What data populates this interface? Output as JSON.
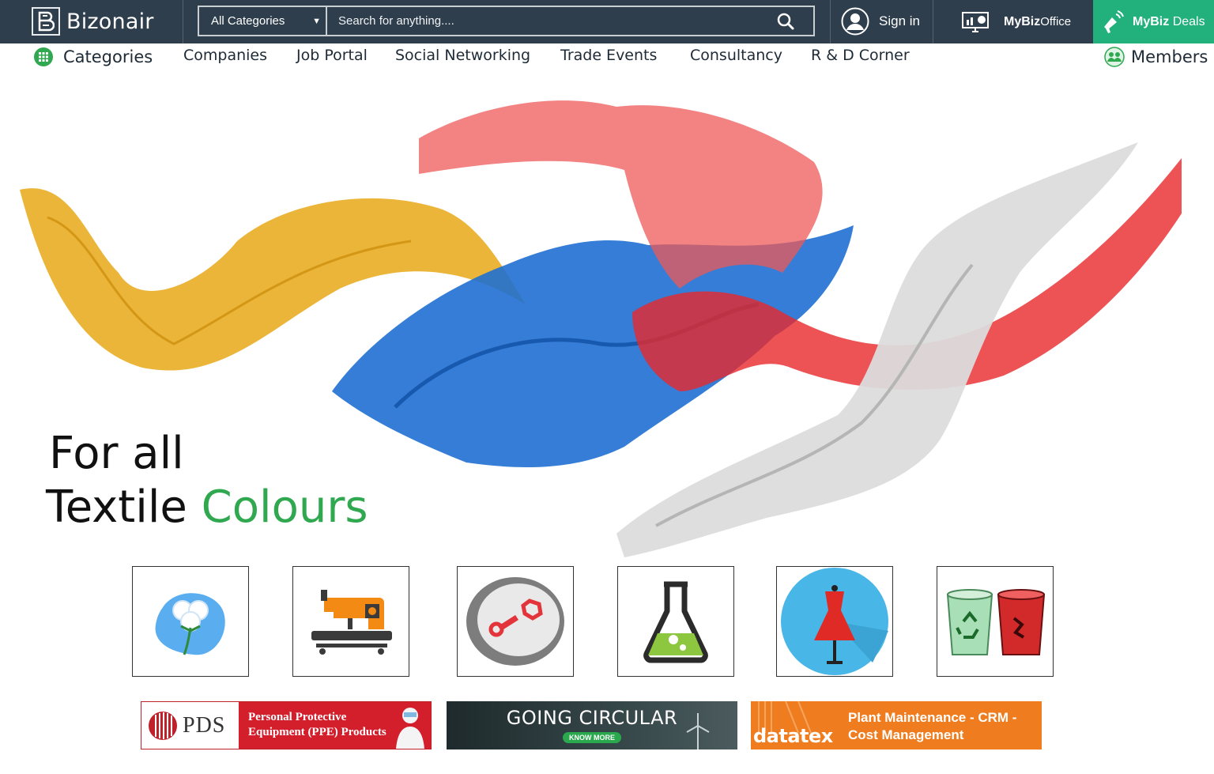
{
  "header": {
    "brand": "Bizonair",
    "category_select": "All Categories",
    "search_placeholder": "Search for anything....",
    "signin": "Sign in",
    "office_strong": "MyBiz",
    "office_light": "Office",
    "deals_strong": "MyBiz",
    "deals_light": "Deals"
  },
  "nav": {
    "items": [
      "Categories",
      "Companies",
      "Job Portal",
      "Social Networking",
      "Trade Events",
      "Consultancy",
      "R & D Corner"
    ],
    "members": "Members"
  },
  "hero": {
    "line1": "For all",
    "line2_a": "Textile",
    "line2_b": "Colours",
    "accent_color": "#2fa84f"
  },
  "tiles": [
    "cotton-icon",
    "sewing-machine-icon",
    "spare-parts-icon",
    "chemical-flask-icon",
    "dress-icon",
    "recycle-bins-icon"
  ],
  "banners": {
    "pds": {
      "brand": "PDS",
      "line1": "Personal Protective",
      "line2": "Equipment (PPE) Products"
    },
    "circular": {
      "title": "GOING CIRCULAR",
      "button": "KNOW MORE"
    },
    "datatex": {
      "brand": "datatex",
      "line1": "Plant Maintenance - CRM -",
      "line2": "Cost Management"
    }
  },
  "colors": {
    "topbar": "#2f3e4c",
    "deals": "#22b07d",
    "pds_red": "#d31e2c",
    "datatex_orange": "#ef7d1f"
  }
}
